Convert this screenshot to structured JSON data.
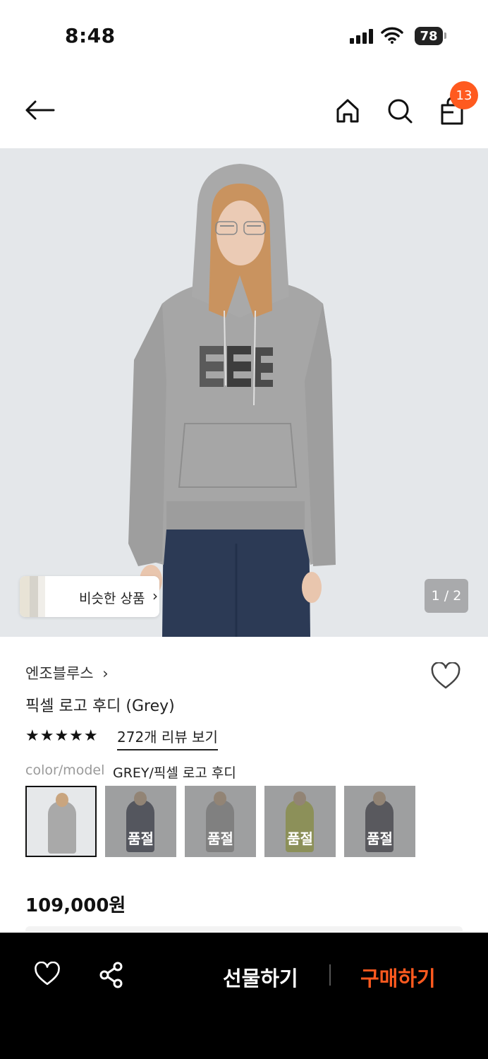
{
  "status": {
    "time": "8:48",
    "battery": "78"
  },
  "nav": {
    "cart_count": "13"
  },
  "hero": {
    "similar_label": "비슷한 상품",
    "pager": "1 / 2"
  },
  "product": {
    "brand": "엔조블루스",
    "name": "픽셀 로고 후디 (Grey)",
    "stars": "★★★★★",
    "reviews": "272개 리뷰 보기",
    "option_label": "color/model",
    "option_value": "GREY/픽셀 로고 후디",
    "swatches": [
      {
        "sold_out": "",
        "color": "#a9a9a9"
      },
      {
        "sold_out": "품절",
        "color": "#2f3447"
      },
      {
        "sold_out": "품절",
        "color": "#9b9b9b"
      },
      {
        "sold_out": "품절",
        "color": "#b9c23a"
      },
      {
        "sold_out": "품절",
        "color": "#3a3a48"
      }
    ],
    "price": "109,000원"
  },
  "bottom": {
    "gift": "선물하기",
    "buy": "구매하기"
  },
  "colors": {
    "accent": "#ff5a1f"
  }
}
